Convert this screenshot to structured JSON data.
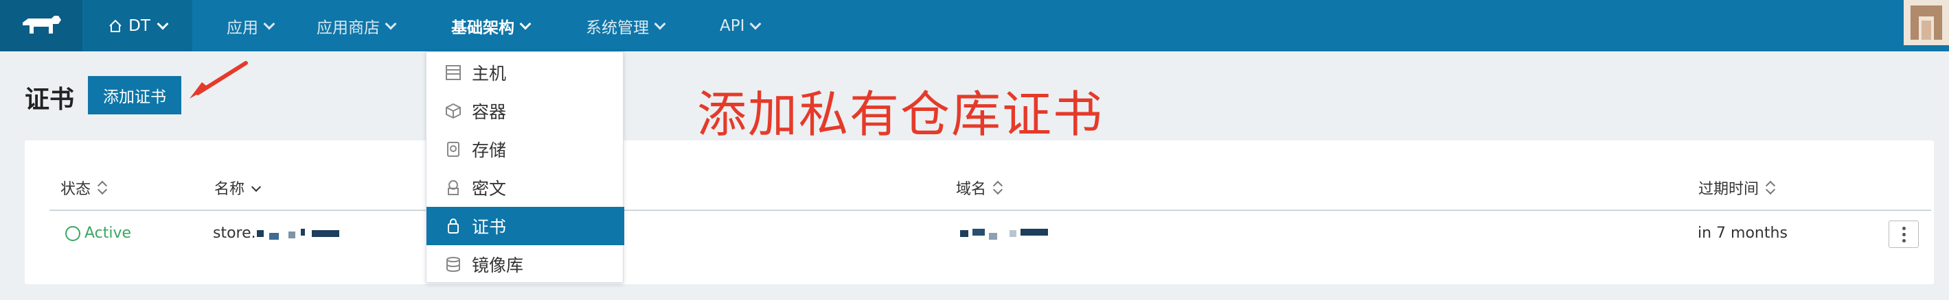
{
  "nav": {
    "environment": "DT",
    "items": [
      {
        "label": "应用"
      },
      {
        "label": "应用商店"
      },
      {
        "label": "基础架构"
      },
      {
        "label": "系统管理"
      },
      {
        "label": "API"
      }
    ]
  },
  "dropdown": {
    "items": [
      {
        "label": "主机",
        "icon": "host-icon"
      },
      {
        "label": "容器",
        "icon": "container-icon"
      },
      {
        "label": "存储",
        "icon": "storage-icon"
      },
      {
        "label": "密文",
        "icon": "secret-icon"
      },
      {
        "label": "证书",
        "icon": "certificate-icon"
      },
      {
        "label": "镜像库",
        "icon": "registry-icon"
      }
    ],
    "active_index": 4
  },
  "page": {
    "title": "证书",
    "add_button": "添加证书",
    "annotation": "添加私有仓库证书"
  },
  "table": {
    "columns": [
      "状态",
      "名称",
      "域名",
      "过期时间"
    ],
    "rows": [
      {
        "status": "Active",
        "name": "store.",
        "expires": "in 7 months"
      }
    ]
  },
  "colors": {
    "brand": "#0e76a8",
    "status_active": "#3aa661",
    "annotation": "#e53a2a"
  }
}
